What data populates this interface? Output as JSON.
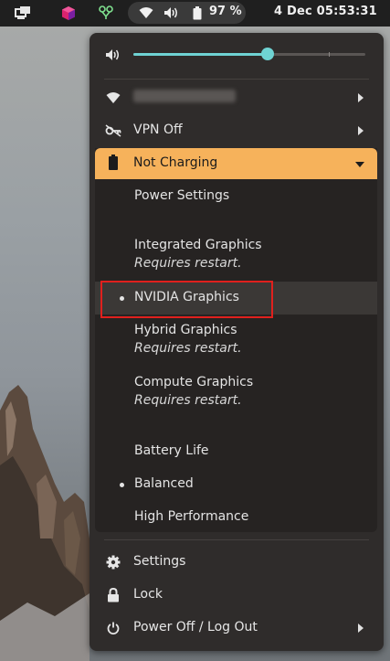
{
  "topbar": {
    "battery_percent": "97 %",
    "clock": "4 Dec  05:53:31",
    "icons": [
      "window-switcher-icon",
      "app-cube-icon",
      "network-tool-icon",
      "wifi-icon",
      "volume-icon",
      "battery-icon"
    ]
  },
  "menu": {
    "volume_level": 0.58,
    "wifi_label": "",
    "vpn_label": "VPN Off",
    "power_label": "Not Charging",
    "power_settings": "Power Settings",
    "graphics": [
      {
        "label": "Integrated Graphics",
        "note": "Requires restart."
      },
      {
        "label": "NVIDIA Graphics",
        "note": "",
        "selected": true
      },
      {
        "label": "Hybrid Graphics",
        "note": "Requires restart."
      },
      {
        "label": "Compute Graphics",
        "note": "Requires restart."
      }
    ],
    "profiles": [
      {
        "label": "Battery Life",
        "selected": false
      },
      {
        "label": "Balanced",
        "selected": true
      },
      {
        "label": "High Performance",
        "selected": false
      }
    ],
    "settings_label": "Settings",
    "lock_label": "Lock",
    "power_off_label": "Power Off / Log Out"
  },
  "colors": {
    "accent": "#f6b25b",
    "slider": "#6fd3d3",
    "highlight_box": "#e0201d"
  }
}
